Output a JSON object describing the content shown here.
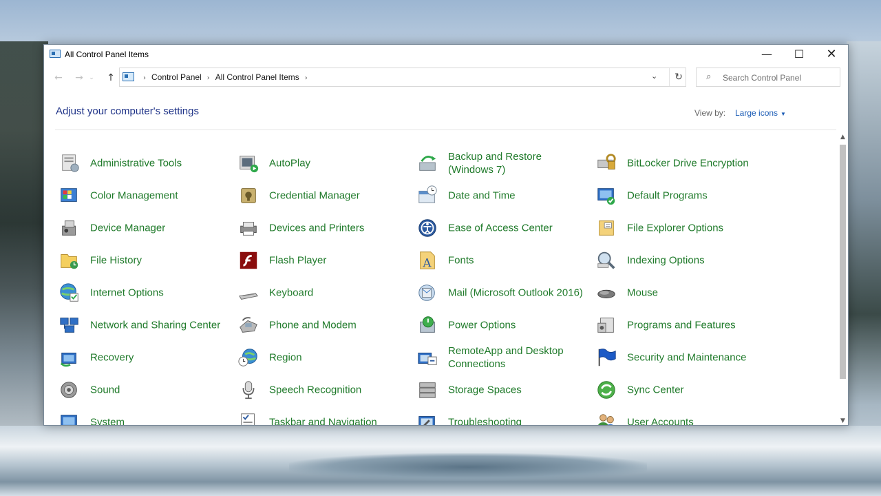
{
  "window": {
    "title": "All Control Panel Items",
    "minimize_glyph": "—",
    "maximize_glyph": "☐",
    "close_glyph": "✕"
  },
  "nav": {
    "back_glyph": "←",
    "forward_glyph": "→",
    "recent_glyph": "⌄",
    "up_glyph": "↑",
    "breadcrumb": [
      "Control Panel",
      "All Control Panel Items"
    ],
    "breadcrumb_sep": "›",
    "history_glyph": "⌄",
    "refresh_glyph": "↻"
  },
  "search": {
    "placeholder": "Search Control Panel",
    "icon_glyph": "⌕"
  },
  "header": {
    "title": "Adjust your computer's settings",
    "view_by_label": "View by:",
    "view_by_value": "Large icons"
  },
  "colors": {
    "link_green": "#1f7a2a",
    "title_blue": "#1e3287",
    "accent_blue": "#1a5bb5"
  },
  "items": [
    {
      "label": "Administrative Tools",
      "icon": "admin-tools-icon"
    },
    {
      "label": "AutoPlay",
      "icon": "autoplay-icon"
    },
    {
      "label": "Backup and Restore (Windows 7)",
      "icon": "backup-restore-icon"
    },
    {
      "label": "BitLocker Drive Encryption",
      "icon": "bitlocker-icon"
    },
    {
      "label": "Color Management",
      "icon": "color-management-icon"
    },
    {
      "label": "Credential Manager",
      "icon": "credential-manager-icon"
    },
    {
      "label": "Date and Time",
      "icon": "date-time-icon"
    },
    {
      "label": "Default Programs",
      "icon": "default-programs-icon"
    },
    {
      "label": "Device Manager",
      "icon": "device-manager-icon"
    },
    {
      "label": "Devices and Printers",
      "icon": "devices-printers-icon"
    },
    {
      "label": "Ease of Access Center",
      "icon": "ease-of-access-icon"
    },
    {
      "label": "File Explorer Options",
      "icon": "file-explorer-options-icon"
    },
    {
      "label": "File History",
      "icon": "file-history-icon"
    },
    {
      "label": "Flash Player",
      "icon": "flash-player-icon"
    },
    {
      "label": "Fonts",
      "icon": "fonts-icon"
    },
    {
      "label": "Indexing Options",
      "icon": "indexing-options-icon"
    },
    {
      "label": "Internet Options",
      "icon": "internet-options-icon"
    },
    {
      "label": "Keyboard",
      "icon": "keyboard-icon"
    },
    {
      "label": "Mail (Microsoft Outlook 2016)",
      "icon": "mail-icon"
    },
    {
      "label": "Mouse",
      "icon": "mouse-icon"
    },
    {
      "label": "Network and Sharing Center",
      "icon": "network-sharing-icon"
    },
    {
      "label": "Phone and Modem",
      "icon": "phone-modem-icon"
    },
    {
      "label": "Power Options",
      "icon": "power-options-icon"
    },
    {
      "label": "Programs and Features",
      "icon": "programs-features-icon"
    },
    {
      "label": "Recovery",
      "icon": "recovery-icon"
    },
    {
      "label": "Region",
      "icon": "region-icon"
    },
    {
      "label": "RemoteApp and Desktop Connections",
      "icon": "remoteapp-icon"
    },
    {
      "label": "Security and Maintenance",
      "icon": "security-maintenance-icon"
    },
    {
      "label": "Sound",
      "icon": "sound-icon"
    },
    {
      "label": "Speech Recognition",
      "icon": "speech-recognition-icon"
    },
    {
      "label": "Storage Spaces",
      "icon": "storage-spaces-icon"
    },
    {
      "label": "Sync Center",
      "icon": "sync-center-icon"
    },
    {
      "label": "System",
      "icon": "system-icon"
    },
    {
      "label": "Taskbar and Navigation",
      "icon": "taskbar-navigation-icon"
    },
    {
      "label": "Troubleshooting",
      "icon": "troubleshooting-icon"
    },
    {
      "label": "User Accounts",
      "icon": "user-accounts-icon"
    }
  ]
}
